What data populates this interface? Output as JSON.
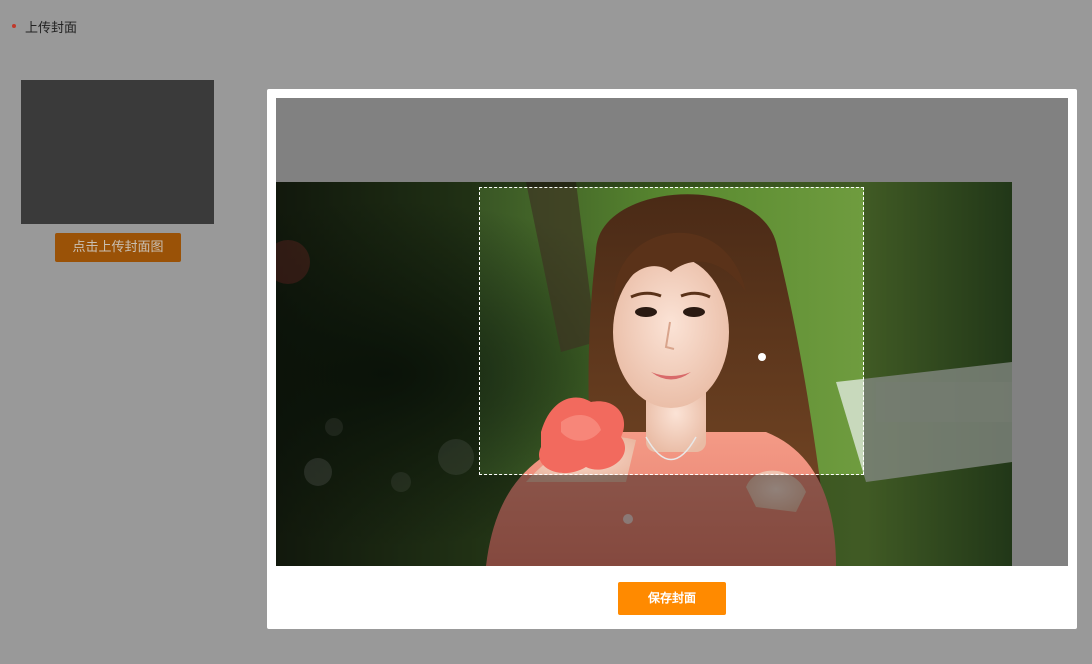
{
  "page": {
    "title": "上传封面"
  },
  "cover": {
    "upload_button_label": "点击上传封面图"
  },
  "crop_dialog": {
    "save_button_label": "保存封面"
  },
  "colors": {
    "page_overlay": "#999999",
    "save_button": "#ff8a00",
    "upload_button_dimmed": "#9a5207",
    "title_bullet": "#c0392b"
  }
}
